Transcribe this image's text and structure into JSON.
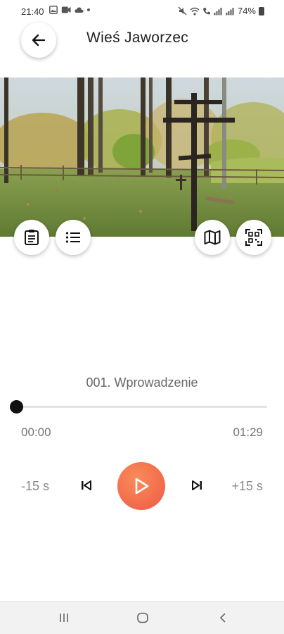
{
  "status_bar": {
    "time": "21:40",
    "battery": "74%",
    "icons": [
      "gallery-icon",
      "video-icon",
      "cloud-icon",
      "dot",
      "mute-icon",
      "wifi-icon",
      "call-icon",
      "signal-icon",
      "signal-icon",
      "battery-icon"
    ]
  },
  "header": {
    "title": "Wieś Jaworzec",
    "back_icon": "arrow-left-icon"
  },
  "photo_buttons": {
    "left": [
      "notes-icon",
      "list-icon"
    ],
    "right": [
      "map-icon",
      "qr-scan-icon"
    ]
  },
  "player": {
    "track_title": "001. Wprowadzenie",
    "current_time": "00:00",
    "total_time": "01:29",
    "progress": 0,
    "skip_back_label": "-15 s",
    "skip_forward_label": "+15 s",
    "accent_color": "#f36d4d"
  },
  "nav_bar": {
    "items": [
      "recents-icon",
      "home-icon",
      "back-icon"
    ]
  }
}
